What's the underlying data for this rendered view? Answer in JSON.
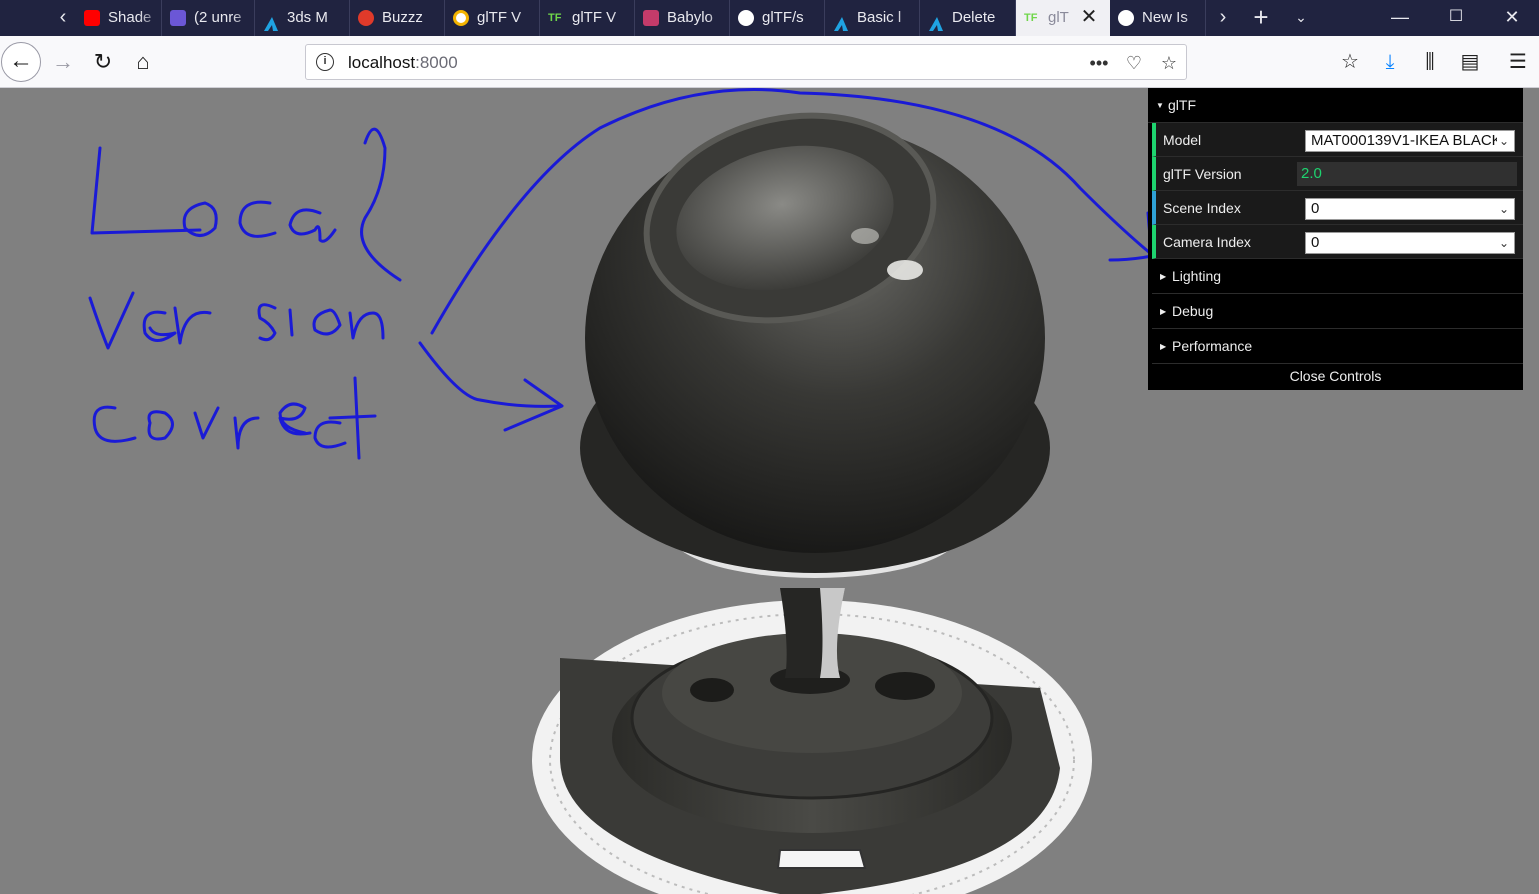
{
  "browser": {
    "tabs": [
      {
        "label": "Shade",
        "favicon": "youtube-icon",
        "color": "#ff0000"
      },
      {
        "label": "(2 unre",
        "favicon": "mail-icon",
        "color": "#6b57d6"
      },
      {
        "label": "3ds M",
        "favicon": "autodesk-icon",
        "color": "#1fa3e2"
      },
      {
        "label": "Buzzz",
        "favicon": "tomato-icon",
        "color": "#e03a2a"
      },
      {
        "label": "glTF V",
        "favicon": "circle-icon",
        "color": "#f4b400"
      },
      {
        "label": "glTF V",
        "favicon": "gltf-icon",
        "color": "#6fd64a"
      },
      {
        "label": "Babylo",
        "favicon": "babylon-icon",
        "color": "#c43b6a"
      },
      {
        "label": "glTF/s",
        "favicon": "github-icon",
        "color": "#ffffff"
      },
      {
        "label": "Basic l",
        "favicon": "autodesk-icon",
        "color": "#1fa3e2"
      },
      {
        "label": "Delete",
        "favicon": "autodesk-icon",
        "color": "#1fa3e2"
      },
      {
        "label": "glT",
        "favicon": "gltf-icon",
        "color": "#6fd64a",
        "active": true
      },
      {
        "label": "New Is",
        "favicon": "github-icon",
        "color": "#ffffff"
      }
    ],
    "url_host": "localhost",
    "url_port": ":8000"
  },
  "gui": {
    "folder": "glTF",
    "rows": {
      "model": {
        "label": "Model",
        "value": "MAT000139V1-IKEA BLACK"
      },
      "version": {
        "label": "glTF Version",
        "value": "2.0"
      },
      "scene": {
        "label": "Scene Index",
        "value": "0"
      },
      "camera": {
        "label": "Camera Index",
        "value": "0"
      }
    },
    "folders": [
      "Lighting",
      "Debug",
      "Performance"
    ],
    "close_label": "Close Controls"
  },
  "annotation": {
    "lines": [
      "Local",
      "version",
      "correct"
    ],
    "color": "#1a1ad6"
  }
}
